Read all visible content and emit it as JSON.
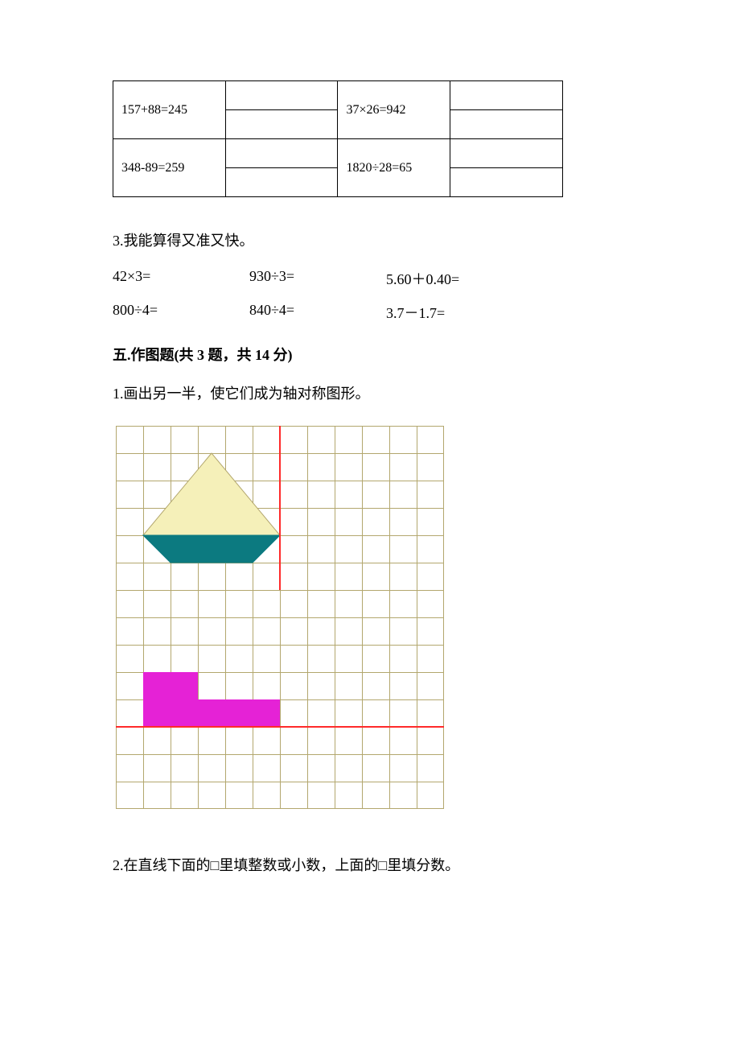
{
  "table": {
    "r1c1": "157+88=245",
    "r1c2": "37×26=942",
    "r2c1": "348-89=259",
    "r2c2": "1820÷28=65"
  },
  "q3": {
    "title": "3.我能算得又准又快。",
    "row1": {
      "a": "42×3=",
      "b": "930÷3=",
      "c": "5.60＋0.40="
    },
    "row2": {
      "a": "800÷4=",
      "b": "840÷4=",
      "c": "3.7－1.7="
    }
  },
  "section5": {
    "title": "五.作图题(共 3 题，共 14 分)",
    "q1": "1.画出另一半，使它们成为轴对称图形。",
    "q2": "2.在直线下面的□里填整数或小数，上面的□里填分数。"
  }
}
